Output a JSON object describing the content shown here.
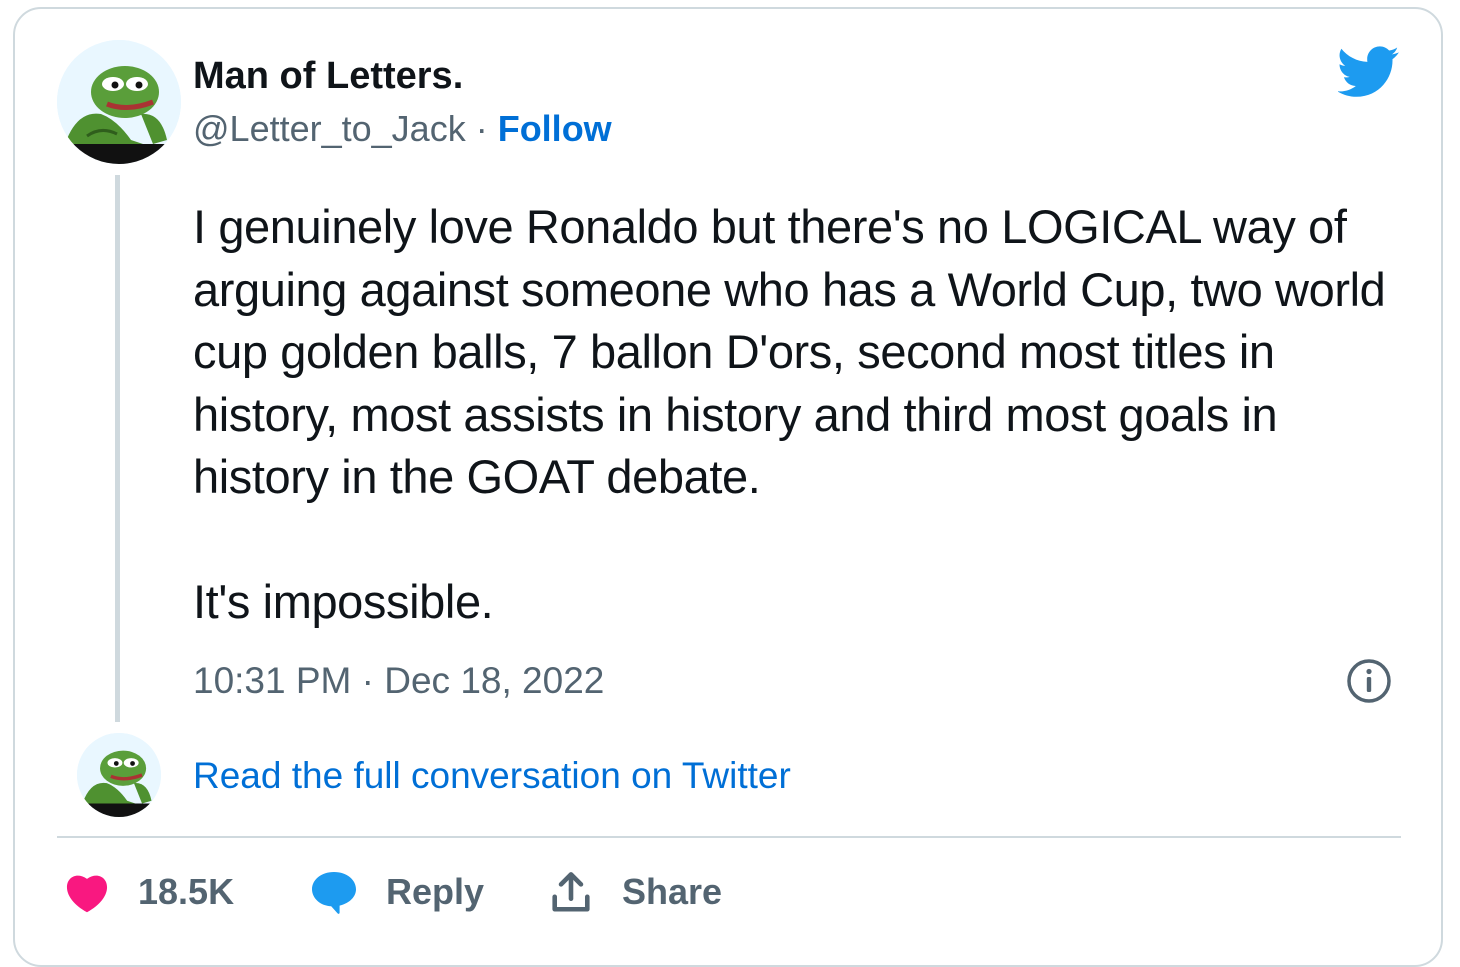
{
  "colors": {
    "text_primary": "#0f1419",
    "text_secondary": "#536471",
    "link_blue": "#006fd6",
    "twitter_blue": "#1d9bf0",
    "like_pink": "#f91880",
    "border": "#cfd9de"
  },
  "author": {
    "display_name": "Man of Letters.",
    "handle": "@Letter_to_Jack",
    "separator": " · ",
    "follow_label": "Follow",
    "avatar_icon": "pepe-frog-avatar"
  },
  "tweet": {
    "paragraphs": [
      "I genuinely love Ronaldo but there's no LOGICAL way of arguing against someone who has a World Cup, two world cup golden balls, 7 ballon D'ors, second most titles in history, most assists in history and third most goals in history in the GOAT debate.",
      "It's impossible."
    ],
    "timestamp": "10:31 PM · Dec 18, 2022"
  },
  "conversation_link": "Read the full conversation on Twitter",
  "actions": {
    "like_count": "18.5K",
    "reply_label": "Reply",
    "share_label": "Share"
  },
  "icons": {
    "brand": "twitter-bird-icon",
    "info": "info-icon",
    "like": "heart-icon",
    "reply": "speech-bubble-icon",
    "share": "share-upload-icon"
  }
}
